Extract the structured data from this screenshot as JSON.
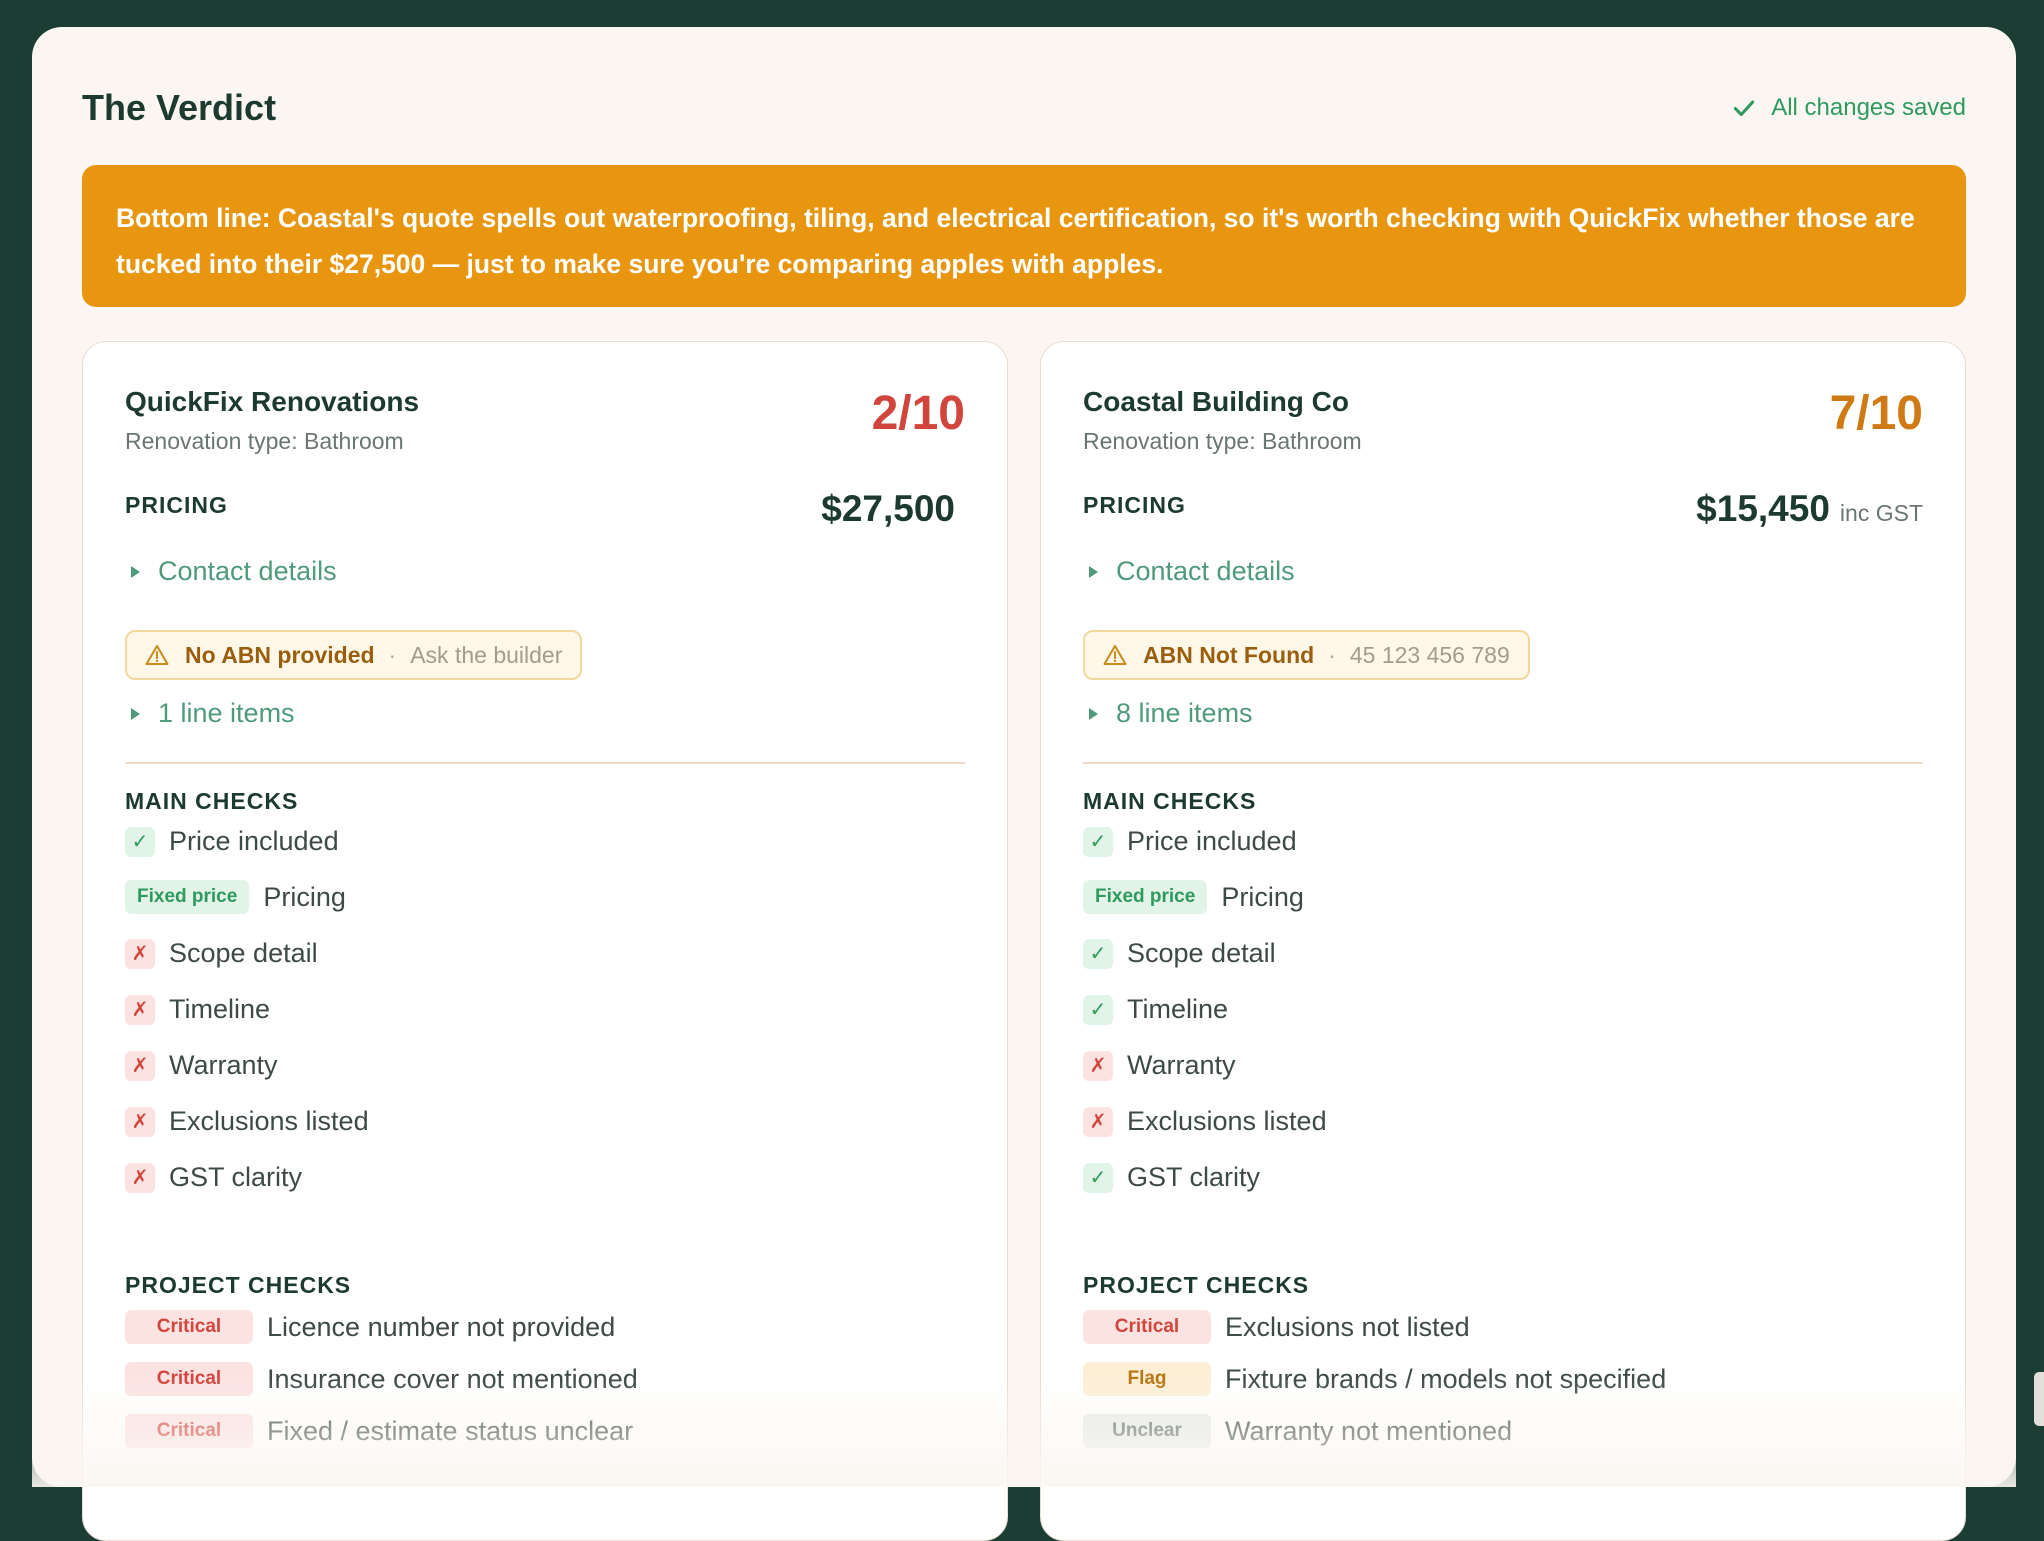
{
  "header": {
    "title": "The Verdict",
    "saved_status": "All changes saved"
  },
  "banner": {
    "text": "Bottom line: Coastal's quote spells out waterproofing, tiling, and electrical certification, so it's worth checking with QuickFix whether those are tucked into their $27,500 — just to make sure you're comparing apples with apples."
  },
  "quotes": [
    {
      "builder": "QuickFix Renovations",
      "renovation_type": "Renovation type: Bathroom",
      "score": "2/10",
      "pricing_label": "PRICING",
      "price": "$27,500",
      "price_suffix": "",
      "contact_label": "Contact details",
      "abn_label": "No ABN provided",
      "abn_separator": "·",
      "abn_detail": "Ask the builder",
      "line_items_label": "1 line items",
      "main_checks_label": "MAIN CHECKS",
      "main_checks": [
        {
          "status": "pass",
          "symbol": "✓",
          "label": "Price included"
        },
        {
          "status": "pill",
          "pill": "Fixed price",
          "label": "Pricing"
        },
        {
          "status": "fail",
          "symbol": "✗",
          "label": "Scope detail"
        },
        {
          "status": "fail",
          "symbol": "✗",
          "label": "Timeline"
        },
        {
          "status": "fail",
          "symbol": "✗",
          "label": "Warranty"
        },
        {
          "status": "fail",
          "symbol": "✗",
          "label": "Exclusions listed"
        },
        {
          "status": "fail",
          "symbol": "✗",
          "label": "GST clarity"
        }
      ],
      "project_checks_label": "PROJECT CHECKS",
      "project_checks": [
        {
          "severity": "Critical",
          "label": "Licence number not provided"
        },
        {
          "severity": "Critical",
          "label": "Insurance cover not mentioned"
        },
        {
          "severity": "Critical",
          "label": "Fixed / estimate status unclear"
        }
      ]
    },
    {
      "builder": "Coastal Building Co",
      "renovation_type": "Renovation type: Bathroom",
      "score": "7/10",
      "pricing_label": "PRICING",
      "price": "$15,450",
      "price_suffix": "inc GST",
      "contact_label": "Contact details",
      "abn_label": "ABN Not Found",
      "abn_separator": "·",
      "abn_detail": "45 123 456 789",
      "line_items_label": "8 line items",
      "main_checks_label": "MAIN CHECKS",
      "main_checks": [
        {
          "status": "pass",
          "symbol": "✓",
          "label": "Price included"
        },
        {
          "status": "pill",
          "pill": "Fixed price",
          "label": "Pricing"
        },
        {
          "status": "pass",
          "symbol": "✓",
          "label": "Scope detail"
        },
        {
          "status": "pass",
          "symbol": "✓",
          "label": "Timeline"
        },
        {
          "status": "fail",
          "symbol": "✗",
          "label": "Warranty"
        },
        {
          "status": "fail",
          "symbol": "✗",
          "label": "Exclusions listed"
        },
        {
          "status": "pass",
          "symbol": "✓",
          "label": "GST clarity"
        }
      ],
      "project_checks_label": "PROJECT CHECKS",
      "project_checks": [
        {
          "severity": "Critical",
          "label": "Exclusions not listed"
        },
        {
          "severity": "Flag",
          "label": "Fixture brands / models not specified"
        },
        {
          "severity": "Unclear",
          "label": "Warranty not mentioned"
        }
      ]
    }
  ],
  "colors": {
    "background": "#1b3d33",
    "panel": "#fbf6f1",
    "banner": "#e8960f",
    "score_low": "#d1453d",
    "score_mid": "#cf7a15",
    "pass": "#2e9a5e",
    "fail": "#d1453d"
  }
}
